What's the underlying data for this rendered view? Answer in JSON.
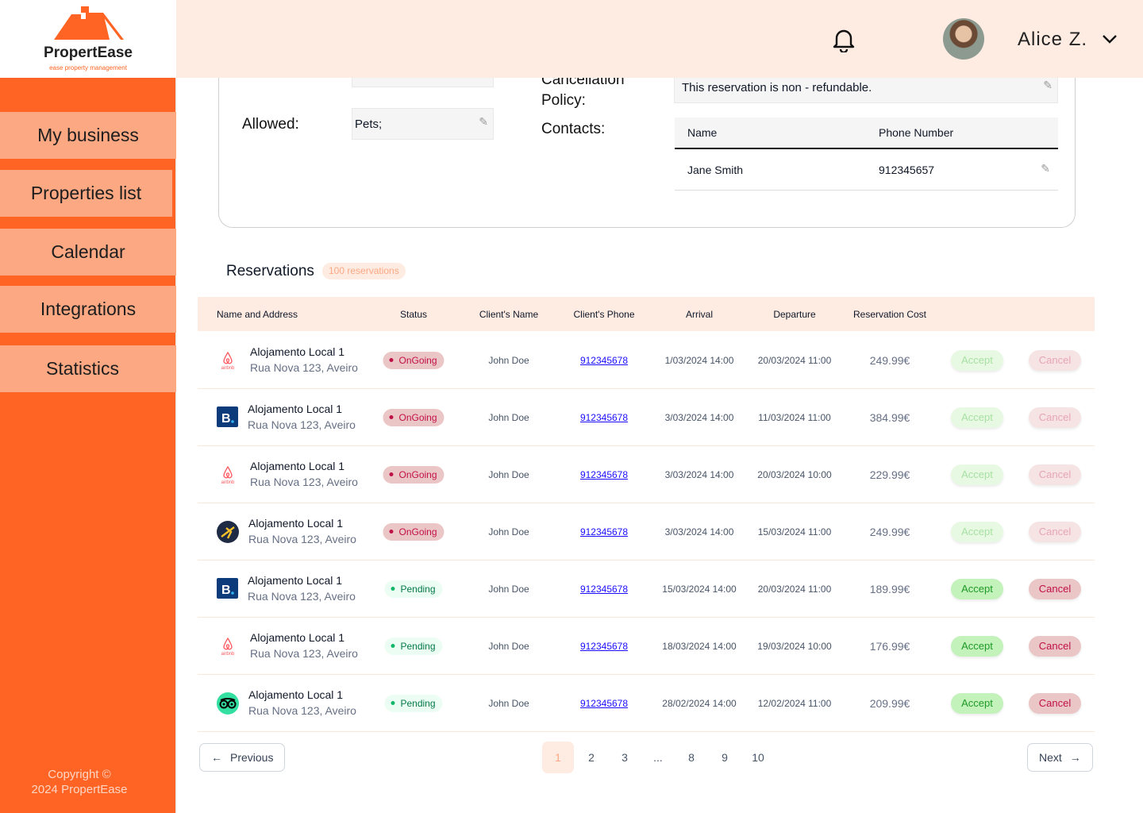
{
  "brand": {
    "name": "PropertEase",
    "tagline": "ease property management",
    "color": "#FF6424"
  },
  "sidebar": {
    "items": [
      {
        "label": "My business"
      },
      {
        "label": "Properties list"
      },
      {
        "label": "Calendar"
      },
      {
        "label": "Integrations"
      },
      {
        "label": "Statistics"
      }
    ],
    "copyright": "Copyright ©",
    "copyright2": "2024 PropertEase"
  },
  "header": {
    "user": "Alice Z.",
    "icons": [
      "bell-icon",
      "chevron-down-icon"
    ]
  },
  "details": {
    "allowed_label": "Allowed:",
    "allowed_value": "Pets;",
    "policy_label1": "Cancellation",
    "policy_label2": "Policy:",
    "policy_value": "This reservation is non - refundable.",
    "contacts_label": "Contacts:",
    "contacts_headers": [
      "Name",
      "Phone Number"
    ],
    "contacts": [
      {
        "name": "Jane Smith",
        "phone": "912345657"
      }
    ]
  },
  "reservations": {
    "title": "Reservations",
    "count": "100 reservations",
    "headers": [
      "Name and Address",
      "Status",
      "Client's Name",
      "Client's Phone",
      "Arrival",
      "Departure",
      "Reservation Cost"
    ],
    "accept": "Accept",
    "cancel": "Cancel",
    "rows": [
      {
        "platform": "airbnb",
        "name": "Alojamento Local 1",
        "address": "Rua Nova 123, Aveiro",
        "status": "OnGoing",
        "client": "John Doe",
        "phone": "912345678",
        "arrival": "1/03/2024 14:00",
        "departure": "20/03/2024 11:00",
        "cost": "249.99€",
        "actions_enabled": false
      },
      {
        "platform": "booking",
        "name": "Alojamento Local 1",
        "address": "Rua Nova 123, Aveiro",
        "status": "OnGoing",
        "client": "John Doe",
        "phone": "912345678",
        "arrival": "3/03/2024 14:00",
        "departure": "11/03/2024 11:00",
        "cost": "384.99€",
        "actions_enabled": false
      },
      {
        "platform": "airbnb",
        "name": "Alojamento Local 1",
        "address": "Rua Nova 123, Aveiro",
        "status": "OnGoing",
        "client": "John Doe",
        "phone": "912345678",
        "arrival": "3/03/2024 14:00",
        "departure": "20/03/2024 10:00",
        "cost": "229.99€",
        "actions_enabled": false
      },
      {
        "platform": "expedia",
        "name": "Alojamento Local 1",
        "address": "Rua Nova 123, Aveiro",
        "status": "OnGoing",
        "client": "John Doe",
        "phone": "912345678",
        "arrival": "3/03/2024 14:00",
        "departure": "15/03/2024 11:00",
        "cost": "249.99€",
        "actions_enabled": false
      },
      {
        "platform": "booking",
        "name": "Alojamento Local 1",
        "address": "Rua Nova 123, Aveiro",
        "status": "Pending",
        "client": "John Doe",
        "phone": "912345678",
        "arrival": "15/03/2024 14:00",
        "departure": "20/03/2024 11:00",
        "cost": "189.99€",
        "actions_enabled": true
      },
      {
        "platform": "airbnb",
        "name": "Alojamento Local 1",
        "address": "Rua Nova 123, Aveiro",
        "status": "Pending",
        "client": "John Doe",
        "phone": "912345678",
        "arrival": "18/03/2024 14:00",
        "departure": "19/03/2024 10:00",
        "cost": "176.99€",
        "actions_enabled": true
      },
      {
        "platform": "tripadvisor",
        "name": "Alojamento Local 1",
        "address": "Rua Nova 123, Aveiro",
        "status": "Pending",
        "client": "John Doe",
        "phone": "912345678",
        "arrival": "28/02/2024 14:00",
        "departure": "12/02/2024 11:00",
        "cost": "209.99€",
        "actions_enabled": true
      }
    ]
  },
  "pagination": {
    "previous": "Previous",
    "next": "Next",
    "pages": [
      "1",
      "2",
      "3",
      "...",
      "8",
      "9",
      "10"
    ],
    "current": "1"
  }
}
